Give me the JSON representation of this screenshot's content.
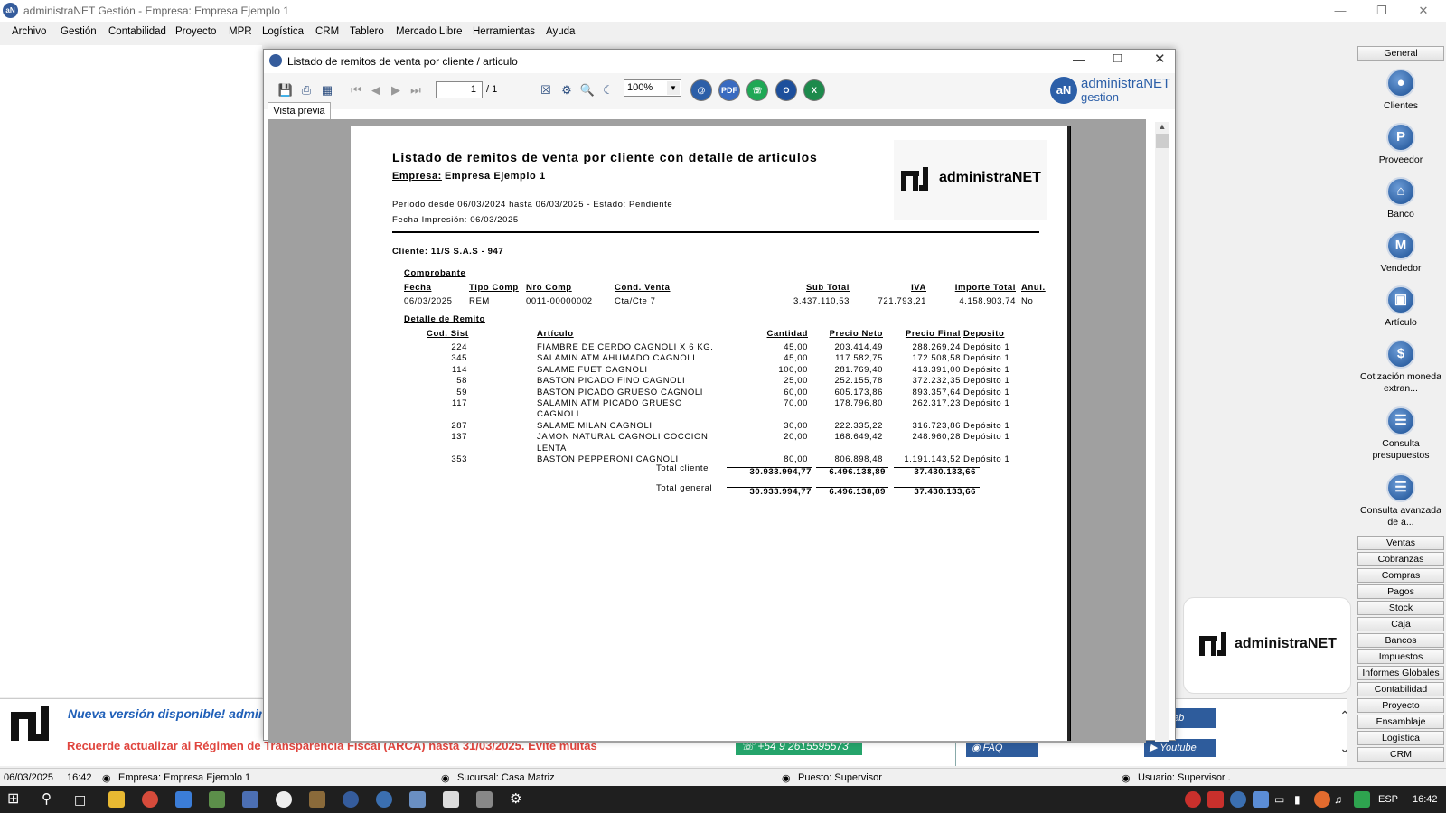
{
  "app": {
    "title": "administraNET Gestión - Empresa: Empresa Ejemplo 1",
    "menu": [
      "Archivo",
      "Gestión",
      "Contabilidad",
      "Proyecto",
      "MPR",
      "Logística",
      "CRM",
      "Tablero",
      "Mercado Libre",
      "Herramientas",
      "Ayuda"
    ]
  },
  "report_window": {
    "title": "Listado de remitos de venta por cliente / articulo",
    "page_current": "1",
    "page_total": "/ 1",
    "zoom": "100%",
    "tab_label": "Vista previa",
    "brand_top": "administraNET",
    "brand_bottom": "gestion"
  },
  "report": {
    "title": "Listado de remitos de venta por cliente con detalle de articulos",
    "company_label": "Empresa:",
    "company_value": "Empresa Ejemplo 1",
    "period": "Periodo desde  06/03/2024 hasta 06/03/2025  - Estado: Pendiente",
    "print_date": "Fecha Impresión: 06/03/2025",
    "logo_text": "administraNET",
    "client": "Cliente: 11/S S.A.S - 947",
    "comprobante_label": "Comprobante",
    "comp_headers": {
      "fecha": "Fecha",
      "tipo": "Tipo Comp",
      "nro": "Nro Comp",
      "cond": "Cond. Venta",
      "subtotal": "Sub Total",
      "iva": "IVA",
      "importe": "Importe Total",
      "anul": "Anul."
    },
    "comp_row": {
      "fecha": "06/03/2025",
      "tipo": "REM",
      "nro": "0011-00000002",
      "cond": "Cta/Cte 7",
      "subtotal": "3.437.110,53",
      "iva": "721.793,21",
      "importe": "4.158.903,74",
      "anul": "No"
    },
    "detalle_label": "Detalle de Remito",
    "det_headers": {
      "cod": "Cod. Sist",
      "art": "Artículo",
      "cant": "Cantidad",
      "neto": "Precio Neto",
      "final": "Precio Final",
      "dep": "Deposito"
    },
    "items": [
      {
        "cod": "224",
        "art": "FIAMBRE DE CERDO  CAGNOLI X 6 KG.",
        "art2": "",
        "cant": "45,00",
        "neto": "203.414,49",
        "final": "288.269,24",
        "dep": "Depósito 1"
      },
      {
        "cod": "345",
        "art": "SALAMIN ATM  AHUMADO CAGNOLI",
        "art2": "",
        "cant": "45,00",
        "neto": "117.582,75",
        "final": "172.508,58",
        "dep": "Depósito 1"
      },
      {
        "cod": "114",
        "art": "SALAME FUET CAGNOLI",
        "art2": "",
        "cant": "100,00",
        "neto": "281.769,40",
        "final": "413.391,00",
        "dep": "Depósito 1"
      },
      {
        "cod": "58",
        "art": "BASTON PICADO FINO CAGNOLI",
        "art2": "",
        "cant": "25,00",
        "neto": "252.155,78",
        "final": "372.232,35",
        "dep": "Depósito 1"
      },
      {
        "cod": "59",
        "art": "BASTON PICADO GRUESO CAGNOLI",
        "art2": "",
        "cant": "60,00",
        "neto": "605.173,86",
        "final": "893.357,64",
        "dep": "Depósito 1"
      },
      {
        "cod": "117",
        "art": "SALAMIN ATM PICADO GRUESO",
        "art2": "CAGNOLI",
        "cant": "70,00",
        "neto": "178.796,80",
        "final": "262.317,23",
        "dep": "Depósito 1"
      },
      {
        "cod": "287",
        "art": "SALAME MILAN CAGNOLI",
        "art2": "",
        "cant": "30,00",
        "neto": "222.335,22",
        "final": "316.723,86",
        "dep": "Depósito 1"
      },
      {
        "cod": "137",
        "art": "JAMON NATURAL CAGNOLI COCCION",
        "art2": "LENTA",
        "cant": "20,00",
        "neto": "168.649,42",
        "final": "248.960,28",
        "dep": "Depósito 1"
      },
      {
        "cod": "353",
        "art": "BASTON PEPPERONI CAGNOLI",
        "art2": "",
        "cant": "80,00",
        "neto": "806.898,48",
        "final": "1.191.143,52",
        "dep": "Depósito 1"
      }
    ],
    "total_cliente_label": "Total cliente",
    "total_cliente": {
      "cant": "30.933.994,77",
      "neto": "6.496.138,89",
      "final": "37.430.133,66"
    },
    "total_general_label": "Total general",
    "total_general": {
      "cant": "30.933.994,77",
      "neto": "6.496.138,89",
      "final": "37.430.133,66"
    }
  },
  "right_panel": {
    "general": "General",
    "shortcuts": [
      {
        "label": "Clientes",
        "icon": "clients-icon"
      },
      {
        "label": "Proveedor",
        "icon": "supplier-icon"
      },
      {
        "label": "Banco",
        "icon": "bank-icon"
      },
      {
        "label": "Vendedor",
        "icon": "seller-icon"
      },
      {
        "label": "Artículo",
        "icon": "article-icon"
      },
      {
        "label": "Cotización moneda extran...",
        "icon": "currency-icon"
      },
      {
        "label": "Consulta presupuestos",
        "icon": "document-icon"
      },
      {
        "label": "Consulta avanzada de a...",
        "icon": "document-icon"
      }
    ],
    "categories": [
      "Ventas",
      "Cobranzas",
      "Compras",
      "Pagos",
      "Stock",
      "Caja",
      "Bancos",
      "Impuestos",
      "Informes Globales",
      "Contabilidad",
      "Proyecto",
      "Ensamblaje",
      "Logística",
      "CRM"
    ]
  },
  "banner": {
    "new_version": "Nueva versión disponible! admin",
    "reminder": "Recuerde actualizar al Régimen de Transparencia Fiscal (ARCA) hasta 31/03/2025. Evite multas",
    "whatsapp": "+54 9 2615595573",
    "faq": "FAQ",
    "web": "eb",
    "youtube": "Youtube",
    "logo_text": "administraNET"
  },
  "status": {
    "date": "06/03/2025",
    "time": "16:42",
    "empresa": "Empresa: Empresa Ejemplo 1",
    "sucursal": "Sucursal: Casa Matriz",
    "puesto": "Puesto: Supervisor",
    "usuario": "Usuario: Supervisor ."
  },
  "taskbar": {
    "lang": "ESP",
    "clock": "16:42"
  }
}
